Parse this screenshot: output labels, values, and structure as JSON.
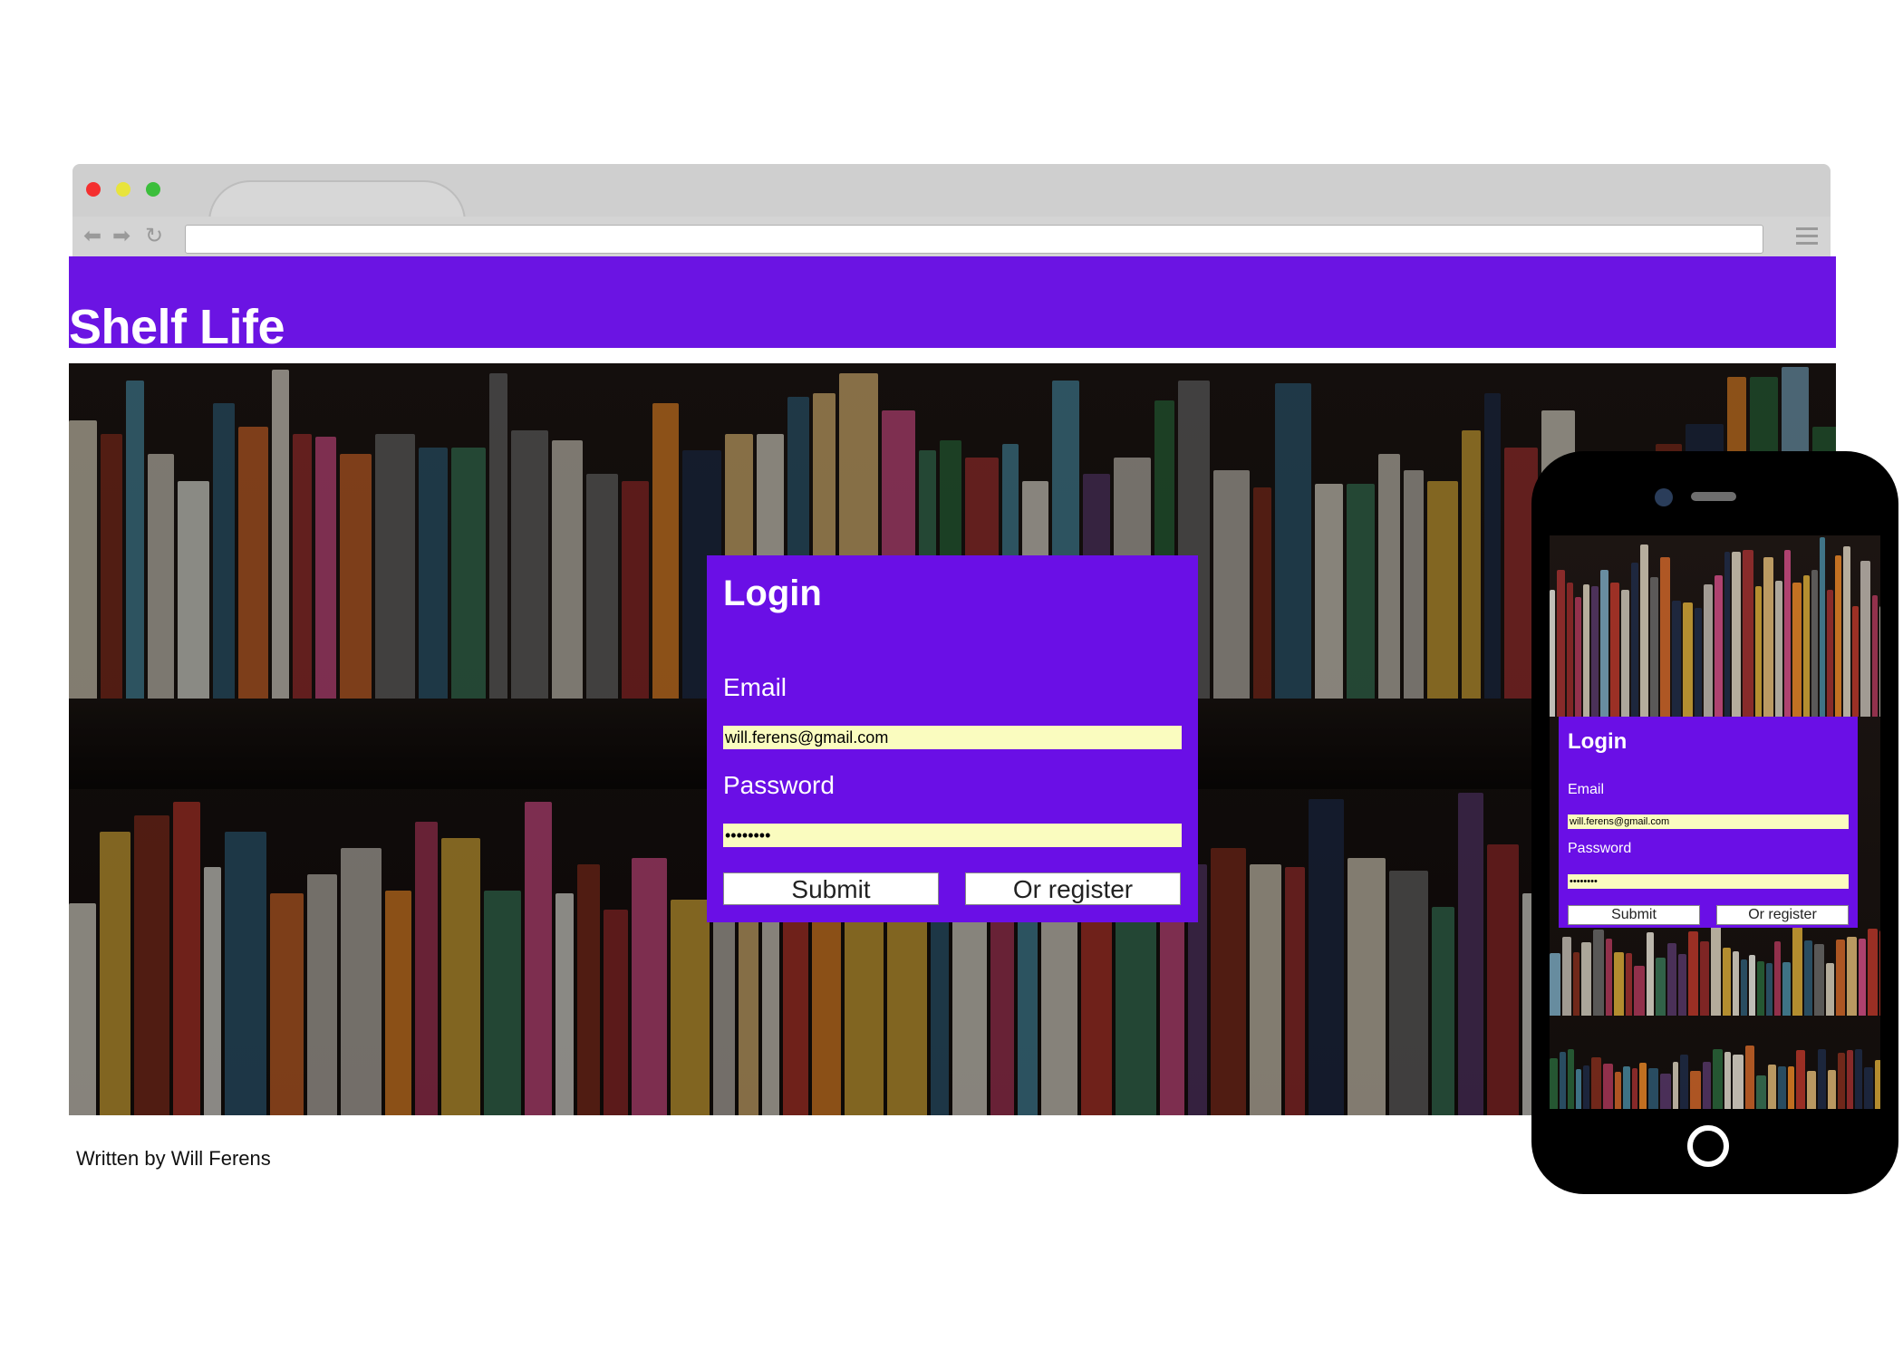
{
  "site": {
    "title": "Shelf Life"
  },
  "login": {
    "heading": "Login",
    "email_label": "Email",
    "email_value": "will.ferens@gmail.com",
    "password_label": "Password",
    "password_value": "••••••••",
    "submit_label": "Submit",
    "register_label": "Or register"
  },
  "footer": {
    "text": "Written by Will Ferens"
  },
  "colors": {
    "header": "#6b14e3",
    "login_panel": "#6a0fe6",
    "input_fill": "#fafcbf"
  },
  "icons": [
    "back-arrow-icon",
    "forward-arrow-icon",
    "reload-icon",
    "hamburger-menu-icon",
    "phone-camera-icon",
    "phone-home-button-icon"
  ]
}
